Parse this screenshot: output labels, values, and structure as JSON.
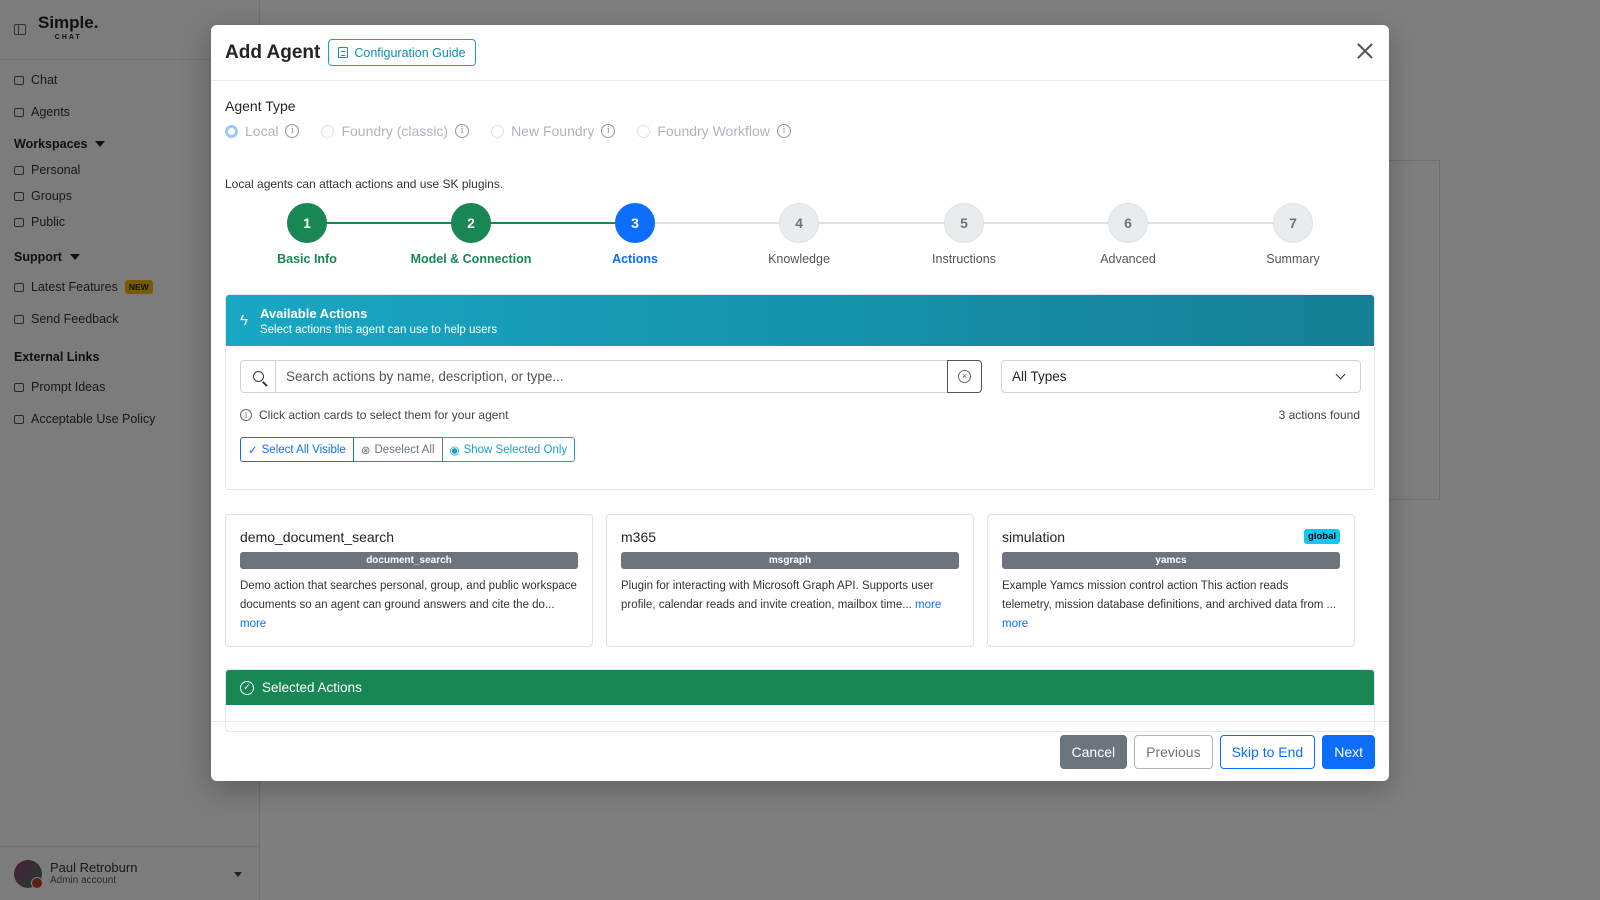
{
  "app": {
    "logo_text": "Simple.",
    "logo_sub": "CHAT"
  },
  "sidebar": {
    "items": [
      {
        "label": "Chat",
        "icon": "chat-icon"
      },
      {
        "label": "Agents",
        "icon": "robot-icon"
      }
    ],
    "workspaces_label": "Workspaces",
    "workspaces": [
      {
        "label": "Personal",
        "icon": "folder-icon"
      },
      {
        "label": "Groups",
        "icon": "folder-icon"
      },
      {
        "label": "Public",
        "icon": "folder-icon"
      }
    ],
    "support_label": "Support",
    "support": [
      {
        "label": "Latest Features",
        "badge": "NEW",
        "icon": "lightning-icon"
      },
      {
        "label": "Send Feedback",
        "icon": "envelope-icon"
      }
    ],
    "external_label": "External Links",
    "external": [
      {
        "label": "Prompt Ideas",
        "icon": "external-link-icon"
      },
      {
        "label": "Acceptable Use Policy",
        "icon": "external-link-icon"
      }
    ],
    "user": {
      "name": "Paul Retroburn",
      "role": "Admin account"
    }
  },
  "modal": {
    "title": "Add Agent",
    "guide_label": "Configuration Guide",
    "agent_type_label": "Agent Type",
    "agent_types": [
      {
        "label": "Local",
        "selected": true
      },
      {
        "label": "Foundry (classic)",
        "selected": false
      },
      {
        "label": "New Foundry",
        "selected": false
      },
      {
        "label": "Foundry Workflow",
        "selected": false
      }
    ],
    "agent_type_note": "Local agents can attach actions and use SK plugins.",
    "steps": [
      {
        "num": "1",
        "label": "Basic Info",
        "state": "done"
      },
      {
        "num": "2",
        "label": "Model & Connection",
        "state": "done"
      },
      {
        "num": "3",
        "label": "Actions",
        "state": "active"
      },
      {
        "num": "4",
        "label": "Knowledge",
        "state": "pending"
      },
      {
        "num": "5",
        "label": "Instructions",
        "state": "pending"
      },
      {
        "num": "6",
        "label": "Advanced",
        "state": "pending"
      },
      {
        "num": "7",
        "label": "Summary",
        "state": "pending"
      }
    ],
    "available": {
      "title": "Available Actions",
      "subtitle": "Select actions this agent can use to help users",
      "search_placeholder": "Search actions by name, description, or type...",
      "type_filter": "All Types",
      "hint": "Click action cards to select them for your agent",
      "found": "3 actions found",
      "select_all": "Select All Visible",
      "deselect_all": "Deselect All",
      "show_selected": "Show Selected Only"
    },
    "actions": [
      {
        "name": "demo_document_search",
        "type": "document_search",
        "desc": "Demo action that searches personal, group, and public workspace documents so an agent can ground answers and cite the do...",
        "more": "more",
        "badge": ""
      },
      {
        "name": "m365",
        "type": "msgraph",
        "desc": "Plugin for interacting with Microsoft Graph API. Supports user profile, calendar reads and invite creation, mailbox time...",
        "more": "more",
        "badge": ""
      },
      {
        "name": "simulation",
        "type": "yamcs",
        "desc": "Example Yamcs mission control action This action reads telemetry, mission database definitions, and archived data from ...",
        "more": "more",
        "badge": "global"
      }
    ],
    "selected_title": "Selected Actions",
    "footer": {
      "cancel": "Cancel",
      "previous": "Previous",
      "skip": "Skip to End",
      "next": "Next"
    }
  },
  "colors": {
    "primary": "#0d6efd",
    "success": "#198754",
    "info": "#17a2c8",
    "secondary": "#6c757d"
  }
}
